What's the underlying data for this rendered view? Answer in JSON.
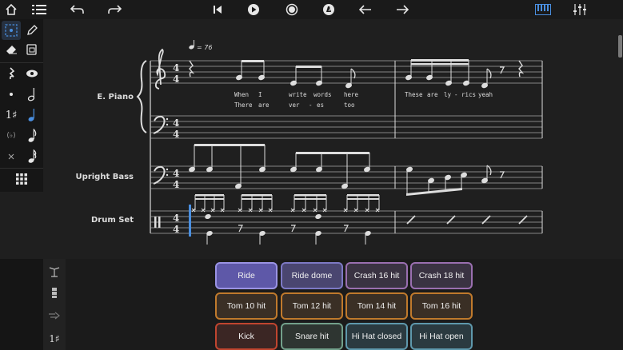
{
  "toolbar": {
    "left": [
      "home-icon",
      "menu-icon"
    ],
    "center": [
      "undo-icon",
      "redo-icon",
      "skip-to-start-icon",
      "play-icon",
      "record-icon",
      "metronome-icon",
      "arrow-left-icon",
      "arrow-right-icon"
    ],
    "right": [
      "piano-keyboard-icon",
      "mixer-icon"
    ],
    "accent": "#4a8fe0"
  },
  "tools": {
    "items": [
      "select-icon",
      "pencil-icon",
      "eraser-icon",
      "clipboard-icon",
      "rest-icon",
      "view-icon",
      "dot-icon",
      "half-note-icon",
      "tuplet-icon",
      "quarter-note-icon",
      "voice-icon",
      "eighth-note-icon",
      "cross-icon",
      "sixteenth-note-icon",
      "grid-icon"
    ],
    "tuplet_label": "1♯",
    "voice_label": "(♭)"
  },
  "score": {
    "tempo": "♩= 76",
    "instruments": [
      {
        "name": "E. Piano"
      },
      {
        "name": "Upright Bass"
      },
      {
        "name": "Drum Set"
      }
    ],
    "time_signature": {
      "top": "4",
      "bottom": "4"
    },
    "lyrics": {
      "verse1": [
        "When",
        "I",
        "write",
        "words",
        "here"
      ],
      "verse2": [
        "There",
        "are",
        "ver",
        "-",
        "es",
        "too"
      ],
      "measure2": [
        "These",
        "are",
        "ly",
        "-",
        "rics",
        "yeah"
      ]
    }
  },
  "drum_pads": {
    "tools_label": "1♯",
    "pads": [
      {
        "label": "Ride",
        "color": "#7d79c4",
        "active": true
      },
      {
        "label": "Ride dome",
        "color": "#7d79c4"
      },
      {
        "label": "Crash 16 hit",
        "color": "#9a6fb0"
      },
      {
        "label": "Crash 18 hit",
        "color": "#9a6fb0"
      },
      {
        "label": "Tom 10 hit",
        "color": "#c07a2c"
      },
      {
        "label": "Tom 12 hit",
        "color": "#c07a2c"
      },
      {
        "label": "Tom 14 hit",
        "color": "#c07a2c"
      },
      {
        "label": "Tom 16 hit",
        "color": "#c07a2c"
      },
      {
        "label": "Kick",
        "color": "#c0452f"
      },
      {
        "label": "Snare hit",
        "color": "#72a08a"
      },
      {
        "label": "Hi Hat closed",
        "color": "#5e98ac"
      },
      {
        "label": "Hi Hat open",
        "color": "#5e98ac"
      }
    ]
  }
}
